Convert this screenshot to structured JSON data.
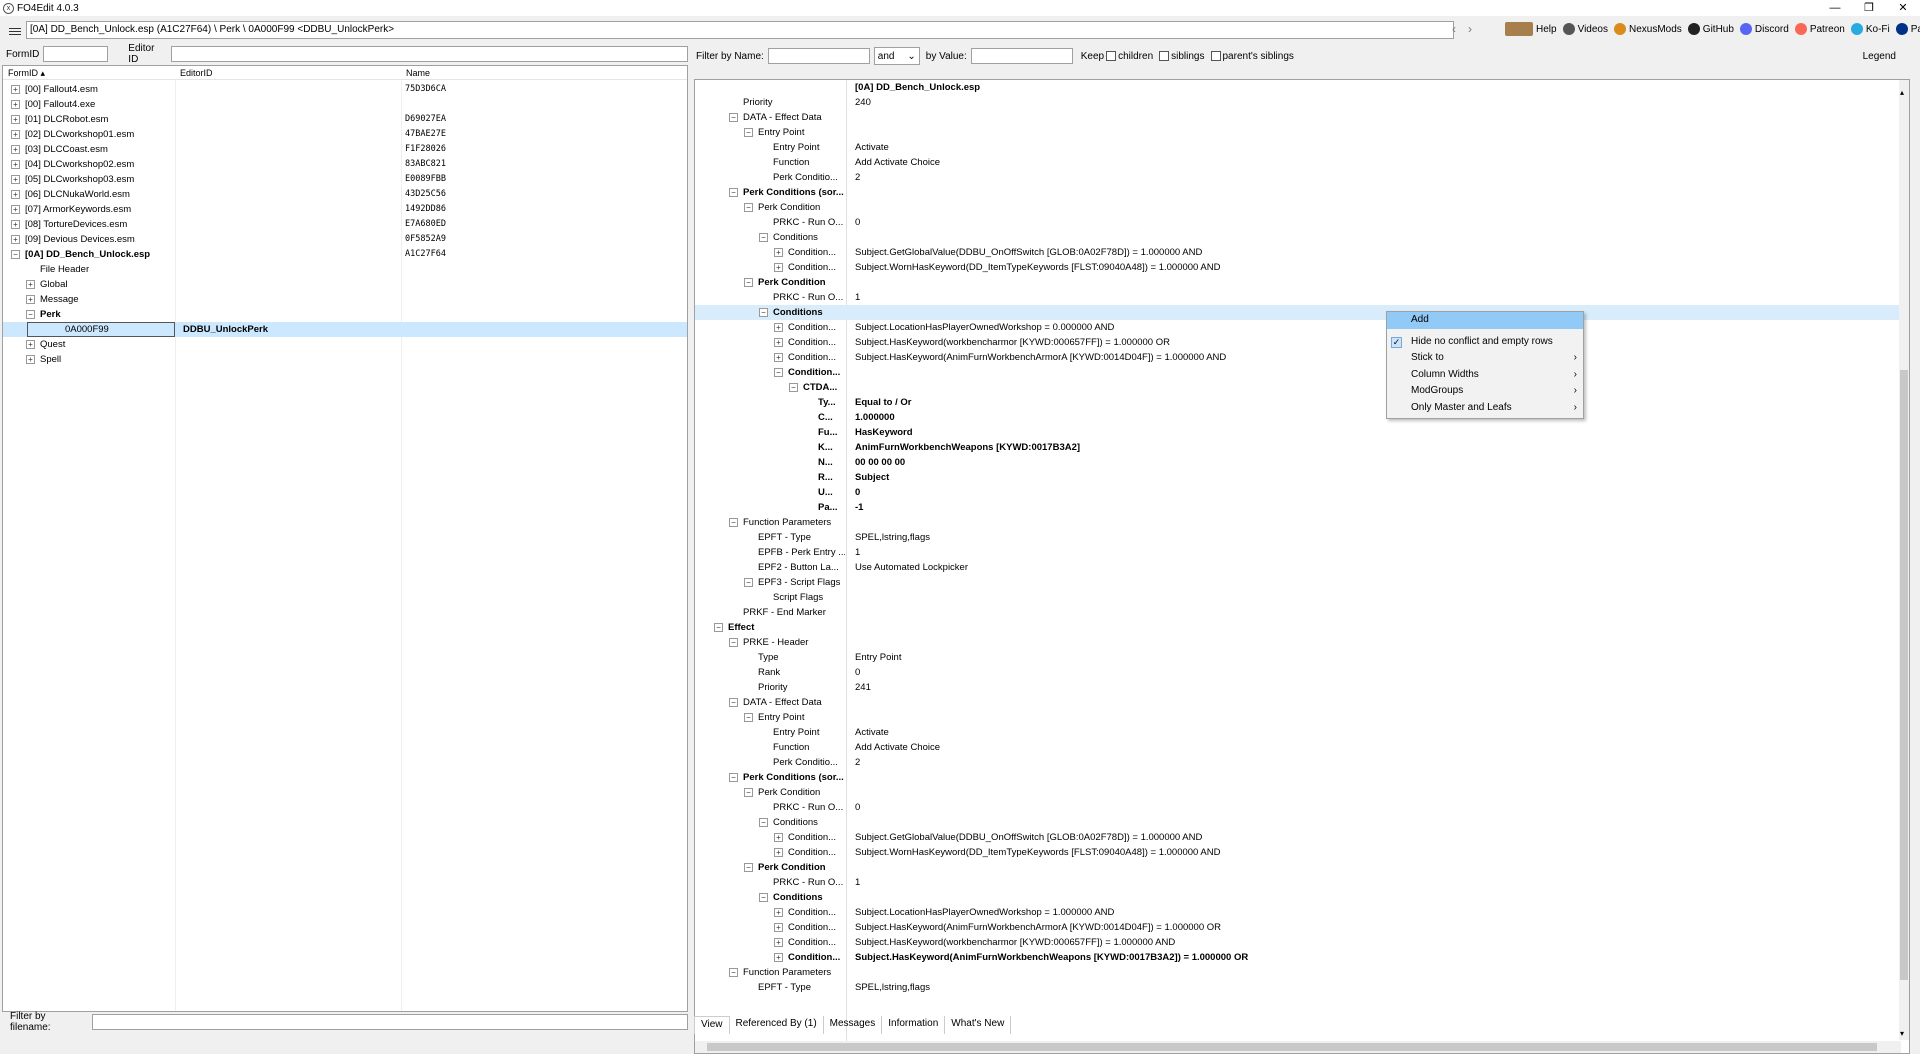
{
  "window": {
    "title": "FO4Edit 4.0.3",
    "icon": "xedit-app-icon"
  },
  "toolbar": {
    "path": "[0A] DD_Bench_Unlock.esp (A1C27F64) \\ Perk \\ 0A000F99 <DDBU_UnlockPerk>",
    "links": [
      {
        "label": "Help",
        "icon": "book-icon"
      },
      {
        "label": "Videos",
        "icon": "videos-icon"
      },
      {
        "label": "NexusMods",
        "icon": "nexusmods-icon"
      },
      {
        "label": "GitHub",
        "icon": "github-icon"
      },
      {
        "label": "Discord",
        "icon": "discord-icon"
      },
      {
        "label": "Patreon",
        "icon": "patreon-icon"
      },
      {
        "label": "Ko-Fi",
        "icon": "kofi-icon"
      },
      {
        "label": "PayPal",
        "icon": "paypal-icon"
      }
    ]
  },
  "left": {
    "formid_label": "FormID",
    "editorid_label": "Editor ID",
    "columns": {
      "formid": "FormID",
      "editorid": "EditorID",
      "name": "Name"
    },
    "filename_filter_label": "Filter by filename:",
    "rows": [
      {
        "indent": 0,
        "exp": "+",
        "text": "[00] Fallout4.esm",
        "hex": "75D3D6CA"
      },
      {
        "indent": 0,
        "exp": "+",
        "text": "[00] Fallout4.exe",
        "hex": ""
      },
      {
        "indent": 0,
        "exp": "+",
        "text": "[01] DLCRobot.esm",
        "hex": "D69027EA"
      },
      {
        "indent": 0,
        "exp": "+",
        "text": "[02] DLCworkshop01.esm",
        "hex": "47BAE27E"
      },
      {
        "indent": 0,
        "exp": "+",
        "text": "[03] DLCCoast.esm",
        "hex": "F1F28026"
      },
      {
        "indent": 0,
        "exp": "+",
        "text": "[04] DLCworkshop02.esm",
        "hex": "83ABC821"
      },
      {
        "indent": 0,
        "exp": "+",
        "text": "[05] DLCworkshop03.esm",
        "hex": "E0089FBB"
      },
      {
        "indent": 0,
        "exp": "+",
        "text": "[06] DLCNukaWorld.esm",
        "hex": "43D25C56"
      },
      {
        "indent": 0,
        "exp": "+",
        "text": "[07] ArmorKeywords.esm",
        "hex": "1492DD86"
      },
      {
        "indent": 0,
        "exp": "+",
        "text": "[08] TortureDevices.esm",
        "hex": "E7A680ED"
      },
      {
        "indent": 0,
        "exp": "+",
        "text": "[09] Devious Devices.esm",
        "hex": "0F5852A9"
      },
      {
        "indent": 0,
        "exp": "−",
        "text": "[0A] DD_Bench_Unlock.esp",
        "hex": "A1C27F64",
        "bold": true
      },
      {
        "indent": 1,
        "exp": "",
        "text": "File Header",
        "hex": ""
      },
      {
        "indent": 1,
        "exp": "+",
        "text": "Global",
        "hex": ""
      },
      {
        "indent": 1,
        "exp": "+",
        "text": "Message",
        "hex": ""
      },
      {
        "indent": 1,
        "exp": "−",
        "text": "Perk",
        "hex": "",
        "bold": true
      },
      {
        "indent": 2,
        "exp": "",
        "text": "0A000F99",
        "hex": "",
        "editorid": "DDBU_UnlockPerk",
        "selected": true
      },
      {
        "indent": 1,
        "exp": "+",
        "text": "Quest",
        "hex": ""
      },
      {
        "indent": 1,
        "exp": "+",
        "text": "Spell",
        "hex": ""
      }
    ]
  },
  "right": {
    "filter_name_label": "Filter by Name:",
    "logic_value": "and",
    "by_value_label": "by Value:",
    "keep_label": "Keep",
    "children_label": "children",
    "siblings_label": "siblings",
    "parents_siblings_label": "parent's siblings",
    "legend_label": "Legend",
    "header_value": "[0A] DD_Bench_Unlock.esp",
    "rows": [
      {
        "i": 2,
        "e": "",
        "l": "Priority",
        "v": "240"
      },
      {
        "i": 2,
        "e": "−",
        "l": "DATA - Effect Data",
        "v": ""
      },
      {
        "i": 3,
        "e": "−",
        "l": "Entry Point",
        "v": ""
      },
      {
        "i": 4,
        "e": "",
        "l": "Entry Point",
        "v": "Activate"
      },
      {
        "i": 4,
        "e": "",
        "l": "Function",
        "v": "Add Activate Choice"
      },
      {
        "i": 4,
        "e": "",
        "l": "Perk Conditio...",
        "v": "2"
      },
      {
        "i": 2,
        "e": "−",
        "l": "Perk Conditions (sor...",
        "v": "",
        "b": true
      },
      {
        "i": 3,
        "e": "−",
        "l": "Perk Condition",
        "v": ""
      },
      {
        "i": 4,
        "e": "",
        "l": "PRKC - Run O...",
        "v": "0"
      },
      {
        "i": 4,
        "e": "−",
        "l": "Conditions",
        "v": ""
      },
      {
        "i": 5,
        "e": "+",
        "l": "Condition...",
        "v": "Subject.GetGlobalValue(DDBU_OnOffSwitch [GLOB:0A02F78D]) = 1.000000 AND"
      },
      {
        "i": 5,
        "e": "+",
        "l": "Condition...",
        "v": "Subject.WornHasKeyword(DD_ItemTypeKeywords [FLST:09040A48]) = 1.000000 AND"
      },
      {
        "i": 3,
        "e": "−",
        "l": "Perk Condition",
        "v": "",
        "b": true
      },
      {
        "i": 4,
        "e": "",
        "l": "PRKC - Run O...",
        "v": "1"
      },
      {
        "i": 4,
        "e": "−",
        "l": "Conditions",
        "v": "",
        "b": true,
        "hl": true
      },
      {
        "i": 5,
        "e": "+",
        "l": "Condition...",
        "v": "Subject.LocationHasPlayerOwnedWorkshop = 0.000000 AND"
      },
      {
        "i": 5,
        "e": "+",
        "l": "Condition...",
        "v": "Subject.HasKeyword(workbencharmor [KYWD:000657FF]) = 1.000000 OR"
      },
      {
        "i": 5,
        "e": "+",
        "l": "Condition...",
        "v": "Subject.HasKeyword(AnimFurnWorkbenchArmorA [KYWD:0014D04F]) = 1.000000 AND"
      },
      {
        "i": 5,
        "e": "−",
        "l": "Condition...",
        "v": "",
        "b": true
      },
      {
        "i": 6,
        "e": "−",
        "l": "CTDA...",
        "v": "",
        "b": true
      },
      {
        "i": 7,
        "e": "",
        "l": "Ty...",
        "v": "Equal to / Or",
        "b": true
      },
      {
        "i": 7,
        "e": "",
        "l": "C...",
        "v": "1.000000",
        "b": true
      },
      {
        "i": 7,
        "e": "",
        "l": "Fu...",
        "v": "HasKeyword",
        "b": true
      },
      {
        "i": 7,
        "e": "",
        "l": "K...",
        "v": "AnimFurnWorkbenchWeapons [KYWD:0017B3A2]",
        "b": true
      },
      {
        "i": 7,
        "e": "",
        "l": "N...",
        "v": "00 00 00 00",
        "b": true
      },
      {
        "i": 7,
        "e": "",
        "l": "R...",
        "v": "Subject",
        "b": true
      },
      {
        "i": 7,
        "e": "",
        "l": "U...",
        "v": "0",
        "b": true
      },
      {
        "i": 7,
        "e": "",
        "l": "Pa...",
        "v": "-1",
        "b": true
      },
      {
        "i": 2,
        "e": "−",
        "l": "Function Parameters",
        "v": ""
      },
      {
        "i": 3,
        "e": "",
        "l": "EPFT - Type",
        "v": "SPEL,lstring,flags"
      },
      {
        "i": 3,
        "e": "",
        "l": "EPFB - Perk Entry ...",
        "v": "1"
      },
      {
        "i": 3,
        "e": "",
        "l": "EPF2 - Button La...",
        "v": "Use Automated Lockpicker"
      },
      {
        "i": 3,
        "e": "−",
        "l": "EPF3 - Script Flags",
        "v": ""
      },
      {
        "i": 4,
        "e": "",
        "l": "Script Flags",
        "v": ""
      },
      {
        "i": 2,
        "e": "",
        "l": "PRKF - End Marker",
        "v": ""
      },
      {
        "i": 1,
        "e": "−",
        "l": "Effect",
        "v": "",
        "b": true
      },
      {
        "i": 2,
        "e": "−",
        "l": "PRKE - Header",
        "v": ""
      },
      {
        "i": 3,
        "e": "",
        "l": "Type",
        "v": "Entry Point"
      },
      {
        "i": 3,
        "e": "",
        "l": "Rank",
        "v": "0"
      },
      {
        "i": 3,
        "e": "",
        "l": "Priority",
        "v": "241"
      },
      {
        "i": 2,
        "e": "−",
        "l": "DATA - Effect Data",
        "v": ""
      },
      {
        "i": 3,
        "e": "−",
        "l": "Entry Point",
        "v": ""
      },
      {
        "i": 4,
        "e": "",
        "l": "Entry Point",
        "v": "Activate"
      },
      {
        "i": 4,
        "e": "",
        "l": "Function",
        "v": "Add Activate Choice"
      },
      {
        "i": 4,
        "e": "",
        "l": "Perk Conditio...",
        "v": "2"
      },
      {
        "i": 2,
        "e": "−",
        "l": "Perk Conditions (sor...",
        "v": "",
        "b": true
      },
      {
        "i": 3,
        "e": "−",
        "l": "Perk Condition",
        "v": ""
      },
      {
        "i": 4,
        "e": "",
        "l": "PRKC - Run O...",
        "v": "0"
      },
      {
        "i": 4,
        "e": "−",
        "l": "Conditions",
        "v": ""
      },
      {
        "i": 5,
        "e": "+",
        "l": "Condition...",
        "v": "Subject.GetGlobalValue(DDBU_OnOffSwitch [GLOB:0A02F78D]) = 1.000000 AND"
      },
      {
        "i": 5,
        "e": "+",
        "l": "Condition...",
        "v": "Subject.WornHasKeyword(DD_ItemTypeKeywords [FLST:09040A48]) = 1.000000 AND"
      },
      {
        "i": 3,
        "e": "−",
        "l": "Perk Condition",
        "v": "",
        "b": true
      },
      {
        "i": 4,
        "e": "",
        "l": "PRKC - Run O...",
        "v": "1"
      },
      {
        "i": 4,
        "e": "−",
        "l": "Conditions",
        "v": "",
        "b": true
      },
      {
        "i": 5,
        "e": "+",
        "l": "Condition...",
        "v": "Subject.LocationHasPlayerOwnedWorkshop = 1.000000 AND"
      },
      {
        "i": 5,
        "e": "+",
        "l": "Condition...",
        "v": "Subject.HasKeyword(AnimFurnWorkbenchArmorA [KYWD:0014D04F]) = 1.000000 OR"
      },
      {
        "i": 5,
        "e": "+",
        "l": "Condition...",
        "v": "Subject.HasKeyword(workbencharmor [KYWD:000657FF]) = 1.000000 AND"
      },
      {
        "i": 5,
        "e": "+",
        "l": "Condition...",
        "v": "Subject.HasKeyword(AnimFurnWorkbenchWeapons [KYWD:0017B3A2]) = 1.000000 OR",
        "b": true
      },
      {
        "i": 2,
        "e": "−",
        "l": "Function Parameters",
        "v": ""
      },
      {
        "i": 3,
        "e": "",
        "l": "EPFT - Type",
        "v": "SPEL,lstring,flags"
      }
    ],
    "tabs": [
      "View",
      "Referenced By (1)",
      "Messages",
      "Information",
      "What's New"
    ]
  },
  "context_menu": {
    "items": [
      {
        "label": "Add",
        "hover": true,
        "submenu": false,
        "checked": false
      },
      {
        "sep": true
      },
      {
        "label": "Hide no conflict and empty rows",
        "submenu": false,
        "checked": true
      },
      {
        "label": "Stick to",
        "submenu": true,
        "checked": false
      },
      {
        "label": "Column Widths",
        "submenu": true,
        "checked": false
      },
      {
        "label": "ModGroups",
        "submenu": true,
        "checked": false
      },
      {
        "label": "Only Master and Leafs",
        "submenu": true,
        "checked": false
      }
    ]
  }
}
